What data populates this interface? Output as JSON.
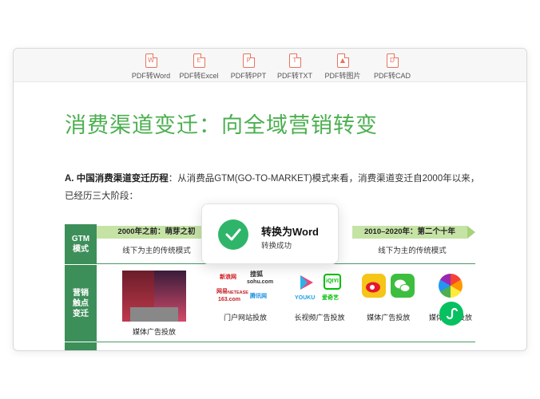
{
  "toolbar": {
    "items": [
      {
        "label": "PDF转Word",
        "glyph": "W",
        "icon": "word-file-icon"
      },
      {
        "label": "PDF转Excel",
        "glyph": "E",
        "icon": "excel-file-icon"
      },
      {
        "label": "PDF转PPT",
        "glyph": "P",
        "icon": "ppt-file-icon"
      },
      {
        "label": "PDF转TXT",
        "glyph": "T",
        "icon": "txt-file-icon"
      },
      {
        "label": "PDF转图片",
        "glyph": "▲",
        "icon": "image-file-icon"
      },
      {
        "label": "PDF转CAD",
        "glyph": "D",
        "icon": "cad-file-icon"
      }
    ]
  },
  "document": {
    "heading": "消费渠道变迁：向全域营销转变",
    "para_bold": "A. 中国消费渠道变迁历程",
    "para_text": "：从消费品GTM(GO-TO-MARKET)模式来看，消费渠道变迁自2000年以来，已经历三大阶段：",
    "table": {
      "row1_label": "GTM\n模式",
      "row2_label": "营销\n触点\n变迁",
      "band1": "2000年之前：萌芽之初",
      "band3": "2010–2020年：第二个十年",
      "sub1": "线下为主的传统模式",
      "sub3": "线下为主的传统模式",
      "cells": [
        {
          "label": "媒体广告投放"
        },
        {
          "label": "门户网站投放",
          "logos": [
            "新浪网",
            "搜狐",
            "sohu.com",
            "网易",
            "NETEASE",
            "163.com",
            "腾讯网"
          ]
        },
        {
          "label": "长视频广告投放",
          "logos": [
            "YOUKU",
            "iQIYI",
            "爱奇艺"
          ]
        },
        {
          "label": "媒体广告投放"
        },
        {
          "label": "媒体广告投放"
        }
      ]
    }
  },
  "toast": {
    "title": "转换为Word",
    "subtitle": "转换成功"
  },
  "colors": {
    "accent_green": "#4caf50",
    "table_green": "#3d8f5a",
    "band_green": "#c6e3a6",
    "toolbar_icon": "#e8725e",
    "success": "#2fb56a"
  }
}
